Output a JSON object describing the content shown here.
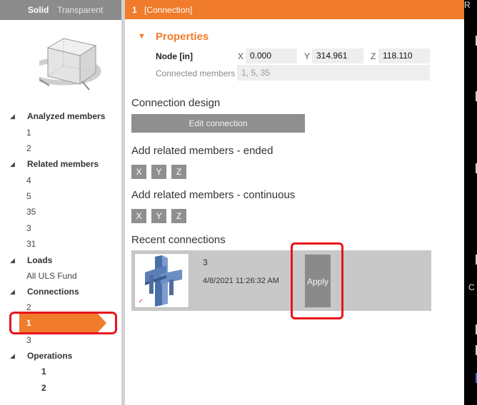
{
  "view_toggle": {
    "solid": "Solid",
    "transparent": "Transparent"
  },
  "tree": {
    "analyzed_members": {
      "label": "Analyzed members",
      "items": [
        "1",
        "2"
      ]
    },
    "related_members": {
      "label": "Related members",
      "items": [
        "4",
        "5",
        "35",
        "3",
        "31"
      ]
    },
    "loads": {
      "label": "Loads",
      "items": [
        "All ULS Fund"
      ]
    },
    "connections": {
      "label": "Connections",
      "items": [
        "2",
        "1",
        "3"
      ],
      "selected": "1"
    },
    "operations": {
      "label": "Operations",
      "items": [
        "1",
        "2"
      ]
    }
  },
  "header": {
    "id": "1",
    "name": "[Connection]"
  },
  "properties": {
    "title": "Properties",
    "node_label": "Node [in]",
    "x_label": "X",
    "x_value": "0.000",
    "y_label": "Y",
    "y_value": "314.961",
    "z_label": "Z",
    "z_value": "118.110",
    "connected_members_label": "Connected members",
    "connected_members_value": "1, 5, 35"
  },
  "connection_design": {
    "title": "Connection design",
    "edit_button": "Edit connection"
  },
  "add_ended": {
    "title": "Add related members - ended",
    "buttons": [
      "X",
      "Y",
      "Z"
    ]
  },
  "add_continuous": {
    "title": "Add related members - continuous",
    "buttons": [
      "X",
      "Y",
      "Z"
    ]
  },
  "recent": {
    "title": "Recent connections",
    "items": [
      {
        "id": "3",
        "date": "4/8/2021 11:26:32 AM",
        "apply_label": "Apply"
      }
    ]
  },
  "right_strip": {
    "top_text": "R",
    "mid_text": "C"
  },
  "colors": {
    "accent": "#f07b2b",
    "highlight": "#e8141b",
    "button_gray": "#8f8f8f"
  }
}
